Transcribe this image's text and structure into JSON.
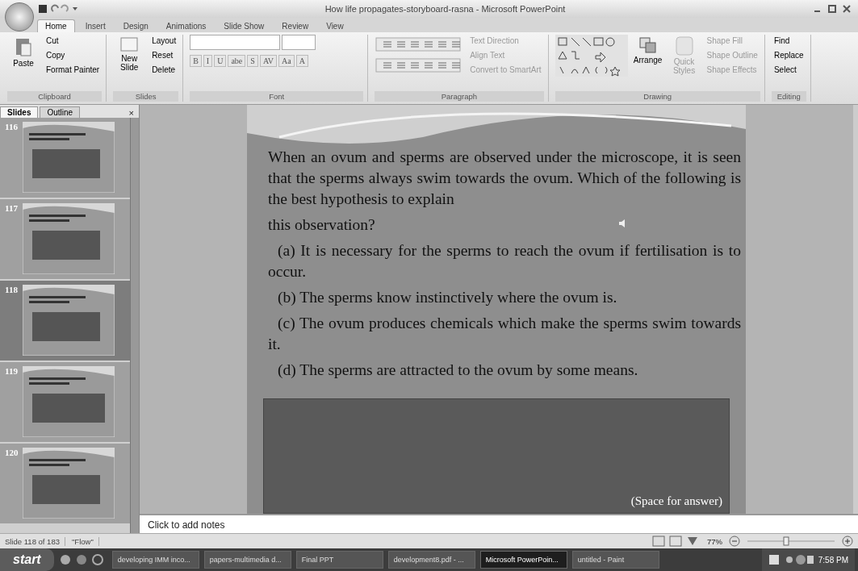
{
  "window": {
    "title": "How life propagates-storyboard-rasna - Microsoft PowerPoint"
  },
  "tabs": [
    {
      "label": "Home",
      "selected": true
    },
    {
      "label": "Insert",
      "selected": false
    },
    {
      "label": "Design",
      "selected": false
    },
    {
      "label": "Animations",
      "selected": false
    },
    {
      "label": "Slide Show",
      "selected": false
    },
    {
      "label": "Review",
      "selected": false
    },
    {
      "label": "View",
      "selected": false
    }
  ],
  "ribbon": {
    "clipboard": {
      "label": "Clipboard",
      "paste": "Paste",
      "items": [
        "Cut",
        "Copy",
        "Format Painter"
      ]
    },
    "slides": {
      "label": "Slides",
      "new_slide": "New Slide",
      "items": [
        "Layout",
        "Reset",
        "Delete"
      ]
    },
    "font": {
      "label": "Font",
      "buttons": [
        "B",
        "I",
        "U",
        "abe",
        "S",
        "AV",
        "Aa",
        "A"
      ]
    },
    "paragraph": {
      "label": "Paragraph",
      "items": [
        {
          "label": "Text Direction",
          "disabled": true
        },
        {
          "label": "Align Text",
          "disabled": true
        },
        {
          "label": "Convert to SmartArt",
          "disabled": true
        }
      ]
    },
    "drawing": {
      "label": "Drawing",
      "arrange": "Arrange",
      "quick_styles": "Quick Styles",
      "items": [
        {
          "label": "Shape Fill",
          "disabled": true
        },
        {
          "label": "Shape Outline",
          "disabled": true
        },
        {
          "label": "Shape Effects",
          "disabled": true
        }
      ]
    },
    "editing": {
      "label": "Editing",
      "items": [
        "Find",
        "Replace",
        "Select"
      ]
    }
  },
  "panel": {
    "close": "×",
    "tabs": [
      {
        "label": "Slides",
        "selected": true
      },
      {
        "label": "Outline",
        "selected": false
      }
    ],
    "thumbnails": [
      {
        "number": "116",
        "selected": false
      },
      {
        "number": "117",
        "selected": false
      },
      {
        "number": "118",
        "selected": true
      },
      {
        "number": "119",
        "selected": false
      },
      {
        "number": "120",
        "selected": false
      }
    ]
  },
  "slide": {
    "paragraphs": [
      "When an ovum and sperms are observed under the microscope, it is seen that the sperms always swim towards the ovum. Which of the following is the best hypothesis to explain",
      "this observation?",
      "(a) It is necessary for the sperms to reach the ovum if fertilisation is to occur.",
      "(b) The sperms know instinctively where the ovum is.",
      "(c) The ovum produces chemicals which make the sperms swim towards it.",
      "(d) The sperms are attracted to the ovum by some means."
    ],
    "answer_label": "(Space for answer)"
  },
  "notes": {
    "placeholder": "Click to add notes"
  },
  "status_bar": {
    "slide_info": "Slide 118 of 183",
    "theme": "\"Flow\"",
    "zoom": "77%",
    "zoom_slider": {
      "level": 0.45
    }
  },
  "taskbar": {
    "start": "start",
    "tasks": [
      {
        "label": "developing IMM inco...",
        "selected": false
      },
      {
        "label": "papers-multimedia d...",
        "selected": false
      },
      {
        "label": "Final PPT",
        "selected": false
      },
      {
        "label": "development8.pdf - ...",
        "selected": false
      },
      {
        "label": "Microsoft PowerPoin...",
        "selected": true
      },
      {
        "label": "untitled - Paint",
        "selected": false
      }
    ],
    "clock": "7:58 PM"
  }
}
